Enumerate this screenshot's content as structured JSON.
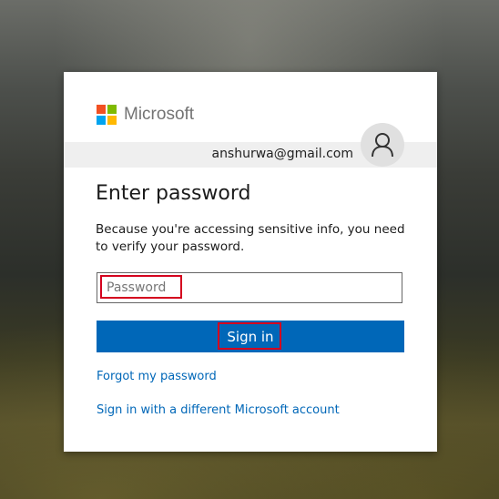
{
  "brand": {
    "name": "Microsoft",
    "logo_colors": [
      "#f25022",
      "#7fba00",
      "#00a4ef",
      "#ffb900"
    ]
  },
  "account": {
    "email": "anshurwa@gmail.com",
    "avatar_icon": "user-icon"
  },
  "form": {
    "title": "Enter password",
    "description": "Because you're accessing sensitive info, you need to verify your password.",
    "password_placeholder": "Password",
    "password_value": "",
    "submit_label": "Sign in"
  },
  "links": {
    "forgot_password": "Forgot my password",
    "different_account": "Sign in with a different Microsoft account"
  },
  "colors": {
    "accent": "#0067b8",
    "highlight": "#d4001e"
  }
}
